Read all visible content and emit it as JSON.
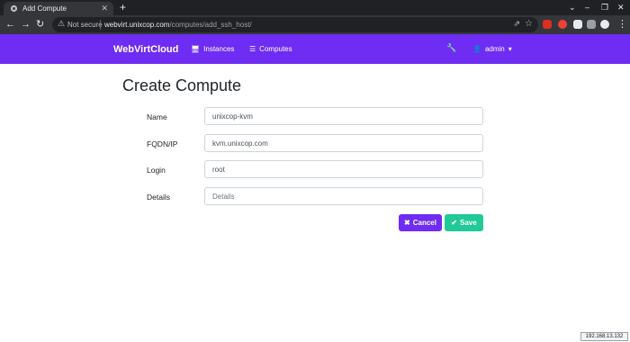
{
  "browser": {
    "tab_title": "Add Compute",
    "new_tab": "+",
    "omnibox": {
      "security_label": "Not secure",
      "url_host": "webvirt.unixcop.com",
      "url_path": "/computes/add_ssh_host/"
    }
  },
  "navbar": {
    "brand": "WebVirtCloud",
    "links": [
      {
        "label": "Instances",
        "icon": "desktop-icon"
      },
      {
        "label": "Computes",
        "icon": "list-icon"
      }
    ],
    "user_label": "admin"
  },
  "page": {
    "title": "Create Compute",
    "form": {
      "name": {
        "label": "Name",
        "value": "unixcop-kvm"
      },
      "fqdn": {
        "label": "FQDN/IP",
        "value": "kvm.unixcop.com"
      },
      "login": {
        "label": "Login",
        "value": "root"
      },
      "details": {
        "label": "Details",
        "value": "",
        "placeholder": "Details"
      }
    },
    "cancel_label": "Cancel",
    "save_label": "Save"
  },
  "overlay": {
    "ip_text": "192.168.13.132"
  },
  "colors": {
    "primary": "#6f2cf3",
    "success": "#20c997",
    "chrome_dark": "#202124"
  }
}
